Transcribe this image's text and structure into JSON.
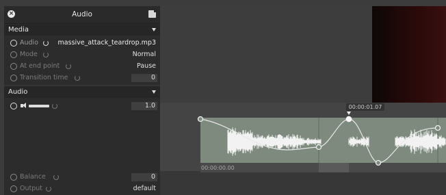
{
  "panel": {
    "title": "Audio",
    "media_section": "Media",
    "audio_section": "Audio",
    "rows": {
      "audio": {
        "label": "Audio",
        "value": "massive_attack_teardrop.mp3"
      },
      "mode": {
        "label": "Mode",
        "value": "Normal"
      },
      "at_end_point": {
        "label": "At end point",
        "value": "Pause"
      },
      "transition_time": {
        "label": "Transition time",
        "value": "0"
      },
      "volume": {
        "value": "1.0"
      },
      "balance": {
        "label": "Balance",
        "value": "0"
      },
      "output": {
        "label": "Output",
        "value": "default"
      }
    }
  },
  "timeline": {
    "playhead_time": "00:00:01.07",
    "start_time": "00:00:00.00"
  },
  "icons": {
    "close": "close-icon",
    "popout": "popout-icon",
    "keyframe": "stopwatch-icon",
    "reset": "reset-icon",
    "speaker": "speaker-icon"
  },
  "colors": {
    "panel_bg": "#2c2c2c",
    "clip_bg": "#7e8a7d",
    "waveform": "#f2f2f2",
    "accent_red": "#3a0f0f"
  }
}
